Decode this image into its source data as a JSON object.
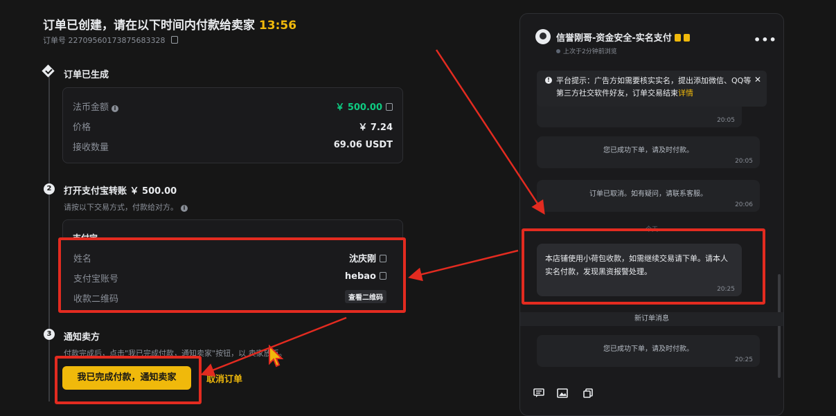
{
  "header": {
    "title": "订单已创建，请在以下时间内付款给卖家",
    "countdown": "13:56",
    "order_label": "订单号",
    "order_number": "22709560173875683328"
  },
  "step1": {
    "title": "订单已生成",
    "rows": [
      {
        "label": "法币金额",
        "value": "￥ 500.00"
      },
      {
        "label": "价格",
        "value": "￥ 7.24"
      },
      {
        "label": "接收数量",
        "value": "69.06 USDT"
      }
    ]
  },
  "step2": {
    "number": "2",
    "title": "打开支付宝转账 ￥ 500.00",
    "subtitle": "请按以下交易方式，付款给对方。",
    "method": "支付宝",
    "rows": [
      {
        "label": "姓名",
        "value": "沈庆刚"
      },
      {
        "label": "支付宝账号",
        "value": "hebao"
      },
      {
        "label": "收款二维码",
        "value": "查看二维码"
      }
    ]
  },
  "step3": {
    "number": "3",
    "title": "通知卖方",
    "subtitle": "付款完成后，点击\"我已完成付款，通知卖家\"按钮，以   卖家放币。",
    "pay_button": "我已完成付款，通知卖家",
    "cancel_button": "取消订单"
  },
  "chat": {
    "name": "信誉刚哥-资金安全-实名支付",
    "status": "上次于2分钟前浏览",
    "notice": "平台提示：广告方如需要核实实名，提出添加微信、QQ等第三方社交软件好友，订单交易结束",
    "notice_link": "详情",
    "messages": [
      {
        "text": "",
        "time": "20:05"
      },
      {
        "text": "您已成功下单，请及时付款。",
        "time": "20:05"
      },
      {
        "text": "订单已取消。如有疑问，请联系客服。",
        "time": "20:06"
      },
      {
        "text": "本店铺使用小荷包收款，如需继续交易请下单。请本人实名付款，发现黑资报警处理。",
        "time": "20:25"
      },
      {
        "text": "您已成功下单，请及时付款。",
        "time": "20:25"
      }
    ],
    "partial_divider": "今天",
    "new_order_divider": "新订单消息"
  },
  "colors": {
    "accent": "#f0b90b",
    "positive": "#0ecb81",
    "highlight": "#e32b20",
    "background": "#161616"
  }
}
